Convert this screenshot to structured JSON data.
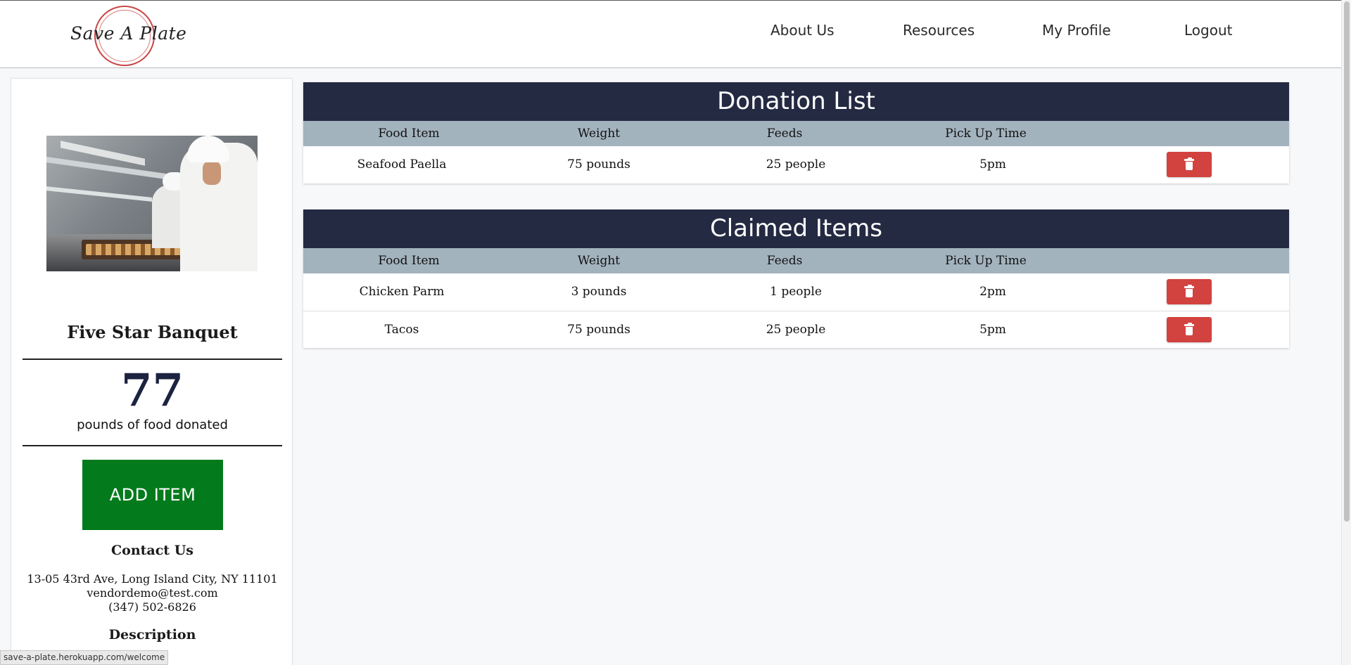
{
  "brand": {
    "logo_text": "Save A Plate"
  },
  "nav": {
    "items": [
      {
        "label": "About Us"
      },
      {
        "label": "Resources"
      },
      {
        "label": "My Profile"
      },
      {
        "label": "Logout"
      }
    ]
  },
  "vendor": {
    "name": "Five Star Banquet",
    "pounds_donated": "77",
    "pounds_label": "pounds of food donated",
    "add_button": "ADD ITEM",
    "contact_title": "Contact Us",
    "address": "13-05 43rd Ave, Long Island City, NY 11101",
    "email": "vendordemo@test.com",
    "phone": "(347) 502-6826",
    "description_title": "Description"
  },
  "donation_list": {
    "title": "Donation List",
    "columns": [
      "Food Item",
      "Weight",
      "Feeds",
      "Pick Up Time"
    ],
    "rows": [
      {
        "item": "Seafood Paella",
        "weight": "75 pounds",
        "feeds": "25 people",
        "time": "5pm"
      }
    ]
  },
  "claimed_items": {
    "title": "Claimed Items",
    "columns": [
      "Food Item",
      "Weight",
      "Feeds",
      "Pick Up Time"
    ],
    "rows": [
      {
        "item": "Chicken Parm",
        "weight": "3 pounds",
        "feeds": "1 people",
        "time": "2pm"
      },
      {
        "item": "Tacos",
        "weight": "75 pounds",
        "feeds": "25 people",
        "time": "5pm"
      }
    ]
  },
  "status_bar": {
    "url": "save-a-plate.herokuapp.com/welcome"
  },
  "colors": {
    "header_dark": "#242a42",
    "column_header": "#a3b3be",
    "add_button": "#037b1c",
    "delete_button": "#d2423f",
    "logo_ring": "#c84444"
  }
}
